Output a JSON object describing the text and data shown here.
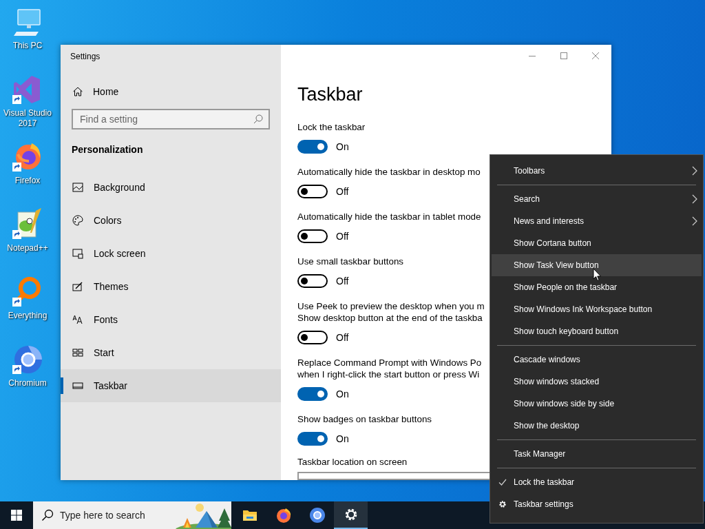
{
  "desktop_icons": [
    {
      "label": "This PC"
    },
    {
      "label": "Visual Studio 2017"
    },
    {
      "label": "Firefox"
    },
    {
      "label": "Notepad++"
    },
    {
      "label": "Everything"
    },
    {
      "label": "Chromium"
    }
  ],
  "window": {
    "title": "Settings"
  },
  "sidebar": {
    "home": "Home",
    "search": {
      "placeholder": "Find a setting"
    },
    "section": "Personalization",
    "items": [
      {
        "label": "Background",
        "selected": false
      },
      {
        "label": "Colors",
        "selected": false
      },
      {
        "label": "Lock screen",
        "selected": false
      },
      {
        "label": "Themes",
        "selected": false
      },
      {
        "label": "Fonts",
        "selected": false
      },
      {
        "label": "Start",
        "selected": false
      },
      {
        "label": "Taskbar",
        "selected": true
      }
    ]
  },
  "page": {
    "title": "Taskbar",
    "settings": [
      {
        "lines": [
          "Lock the taskbar"
        ],
        "on": true,
        "state": "On"
      },
      {
        "lines": [
          "Automatically hide the taskbar in desktop mo"
        ],
        "on": false,
        "state": "Off"
      },
      {
        "lines": [
          "Automatically hide the taskbar in tablet mode"
        ],
        "on": false,
        "state": "Off"
      },
      {
        "lines": [
          "Use small taskbar buttons"
        ],
        "on": false,
        "state": "Off"
      },
      {
        "lines": [
          "Use Peek to preview the desktop when you m",
          "Show desktop button at the end of the taskba"
        ],
        "on": false,
        "state": "Off"
      },
      {
        "lines": [
          "Replace Command Prompt with Windows Po",
          "when I right-click the start button or press Wi"
        ],
        "on": true,
        "state": "On"
      },
      {
        "lines": [
          "Show badges on taskbar buttons"
        ],
        "on": true,
        "state": "On"
      }
    ],
    "location_label": "Taskbar location on screen"
  },
  "context_menu": {
    "groups": [
      {
        "items": [
          {
            "label": "Toolbars",
            "kind": "submenu",
            "highlighted": false
          }
        ]
      },
      {
        "items": [
          {
            "label": "Search",
            "kind": "submenu",
            "highlighted": false
          },
          {
            "label": "News and interests",
            "kind": "submenu",
            "highlighted": false
          },
          {
            "label": "Show Cortana button",
            "kind": "plain",
            "highlighted": false
          },
          {
            "label": "Show Task View button",
            "kind": "plain",
            "highlighted": true
          },
          {
            "label": "Show People on the taskbar",
            "kind": "plain",
            "highlighted": false
          },
          {
            "label": "Show Windows Ink Workspace button",
            "kind": "plain",
            "highlighted": false
          },
          {
            "label": "Show touch keyboard button",
            "kind": "plain",
            "highlighted": false
          }
        ]
      },
      {
        "items": [
          {
            "label": "Cascade windows",
            "kind": "plain",
            "highlighted": false
          },
          {
            "label": "Show windows stacked",
            "kind": "plain",
            "highlighted": false
          },
          {
            "label": "Show windows side by side",
            "kind": "plain",
            "highlighted": false
          },
          {
            "label": "Show the desktop",
            "kind": "plain",
            "highlighted": false
          }
        ]
      },
      {
        "items": [
          {
            "label": "Task Manager",
            "kind": "plain",
            "highlighted": false
          }
        ]
      },
      {
        "items": [
          {
            "label": "Lock the taskbar",
            "kind": "check",
            "checked": true,
            "highlighted": false
          },
          {
            "label": "Taskbar settings",
            "kind": "settings",
            "highlighted": false
          }
        ]
      }
    ]
  },
  "taskbar": {
    "search": {
      "placeholder": "Type here to search"
    },
    "apps": [
      {
        "active": false
      },
      {
        "active": false
      },
      {
        "active": false
      },
      {
        "active": true
      }
    ]
  }
}
